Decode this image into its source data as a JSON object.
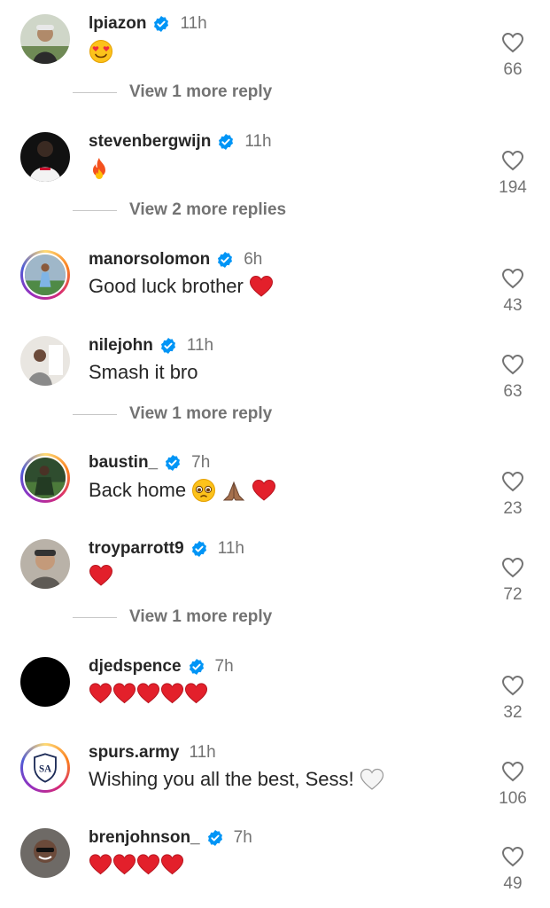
{
  "comments": [
    {
      "username": "lpiazon",
      "verified": true,
      "time": "11h",
      "text": "",
      "emoji": [
        "smiling-heart-eyes"
      ],
      "likes": "66",
      "more": "View 1 more reply"
    },
    {
      "username": "stevenbergwijn",
      "verified": true,
      "time": "11h",
      "text": "",
      "emoji": [
        "fire"
      ],
      "likes": "194",
      "more": "View 2 more replies"
    },
    {
      "username": "manorsolomon",
      "verified": true,
      "time": "6h",
      "text": "Good luck brother",
      "emoji": [
        "red-heart"
      ],
      "likes": "43",
      "more": ""
    },
    {
      "username": "nilejohn",
      "verified": true,
      "time": "11h",
      "text": "Smash it bro",
      "emoji": [],
      "likes": "63",
      "more": "View 1 more reply"
    },
    {
      "username": "baustin_",
      "verified": true,
      "time": "7h",
      "text": "Back home",
      "emoji": [
        "pleading-face",
        "folded-hands",
        "red-heart"
      ],
      "likes": "23",
      "more": ""
    },
    {
      "username": "troyparrott9",
      "verified": true,
      "time": "11h",
      "text": "",
      "emoji": [
        "red-heart"
      ],
      "likes": "72",
      "more": "View 1 more reply"
    },
    {
      "username": "djedspence",
      "verified": true,
      "time": "7h",
      "text": "",
      "emoji": [
        "red-heart",
        "red-heart",
        "red-heart",
        "red-heart",
        "red-heart"
      ],
      "likes": "32",
      "more": ""
    },
    {
      "username": "spurs.army",
      "verified": false,
      "time": "11h",
      "text": "Wishing you all the best, Sess!",
      "emoji": [
        "white-heart"
      ],
      "likes": "106",
      "more": "",
      "avatar_text": "SA"
    },
    {
      "username": "brenjohnson_",
      "verified": true,
      "time": "7h",
      "text": "",
      "emoji": [
        "red-heart",
        "red-heart",
        "red-heart",
        "red-heart"
      ],
      "likes": "49",
      "more": ""
    }
  ],
  "colors": {
    "verified": "#0095f6",
    "muted": "#737373",
    "text": "#262626"
  }
}
